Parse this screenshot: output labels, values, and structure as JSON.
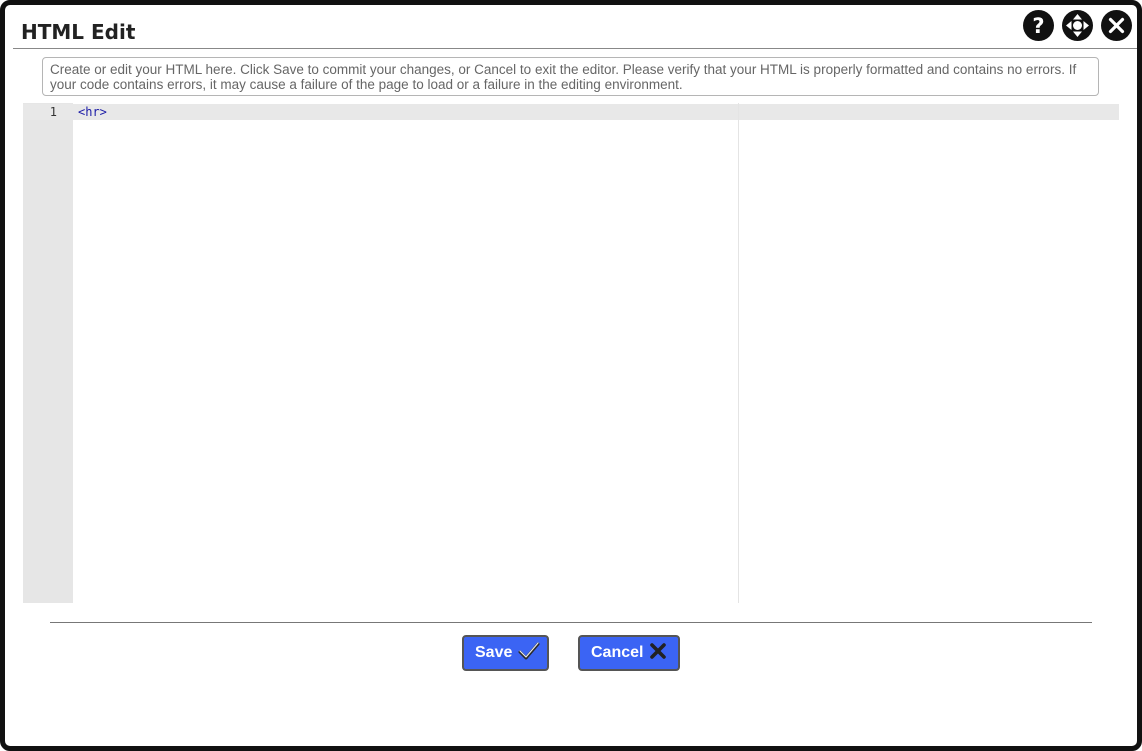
{
  "dialog": {
    "title": "HTML Edit",
    "help_icon": "question-circle-icon",
    "move_icon": "move-arrows-icon",
    "close_icon": "close-x-icon"
  },
  "instructions": "Create or edit your HTML here. Click Save to commit your changes, or Cancel to exit the editor. Please verify that your HTML is properly formatted and contains no errors. If your code contains errors, it may cause a failure of the page to load or a failure in the editing environment.",
  "editor": {
    "lines": [
      {
        "number": "1",
        "text": "<hr>"
      }
    ]
  },
  "buttons": {
    "save_label": "Save",
    "save_icon": "checkmark-icon",
    "cancel_label": "Cancel",
    "cancel_icon": "x-icon"
  },
  "colors": {
    "button_bg": "#3b64f4",
    "code_tag": "#1a1aa6"
  }
}
